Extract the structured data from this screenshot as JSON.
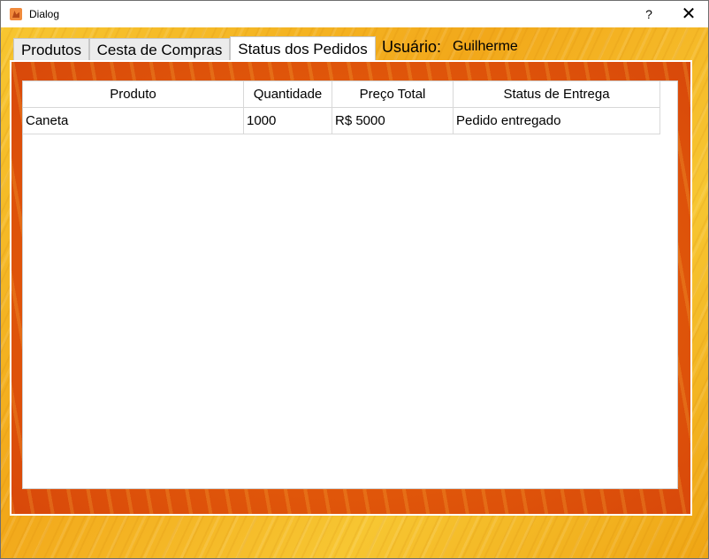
{
  "window": {
    "title": "Dialog",
    "help_label": "?",
    "close_label": "✕",
    "app_icon": "app-icon"
  },
  "tabs": [
    {
      "label": "Produtos",
      "active": false
    },
    {
      "label": "Cesta de Compras",
      "active": false
    },
    {
      "label": "Status dos Pedidos",
      "active": true
    }
  ],
  "user": {
    "label": "Usuário:",
    "name": "Guilherme"
  },
  "table": {
    "columns": [
      "Produto",
      "Quantidade",
      "Preço Total",
      "Status de Entrega"
    ],
    "rows": [
      [
        "Caneta",
        "1000",
        "R$ 5000",
        "Pedido entregado"
      ]
    ]
  },
  "colors": {
    "background": "#f4b21c",
    "pane": "#e25a0a",
    "accent": "#ffffff"
  }
}
